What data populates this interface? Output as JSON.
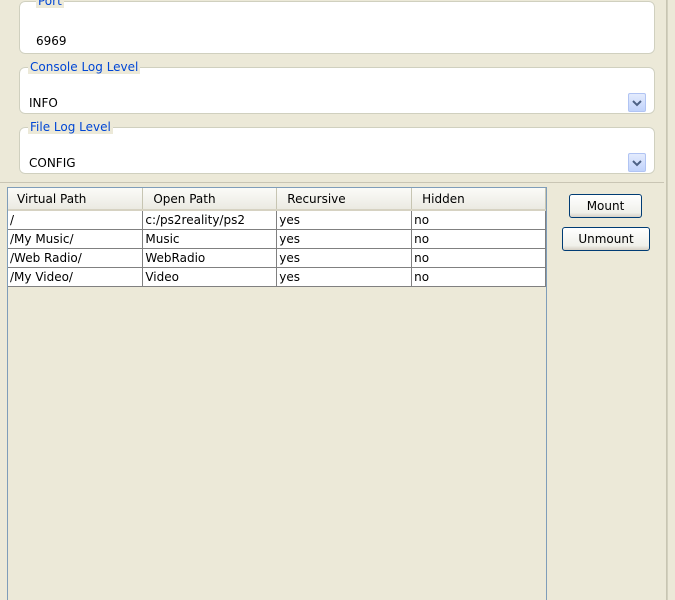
{
  "port": {
    "legend": "Port",
    "value": "6969"
  },
  "console_log_level": {
    "legend": "Console Log Level",
    "value": "INFO",
    "icon": "chevron-down-icon"
  },
  "file_log_level": {
    "legend": "File Log Level",
    "value": "CONFIG",
    "icon": "chevron-down-icon"
  },
  "table": {
    "columns": [
      "Virtual Path",
      "Open Path",
      "Recursive",
      "Hidden"
    ],
    "rows": [
      [
        "/",
        "c:/ps2reality/ps2",
        "yes",
        "no"
      ],
      [
        "/My Music/",
        "Music",
        "yes",
        "no"
      ],
      [
        "/Web Radio/",
        "WebRadio",
        "yes",
        "no"
      ],
      [
        "/My Video/",
        "Video",
        "yes",
        "no"
      ]
    ]
  },
  "buttons": {
    "mount": "Mount",
    "unmount": "Unmount"
  },
  "colors": {
    "legend_text": "#0046d5",
    "window_bg": "#ece9d8",
    "button_border": "#003c74"
  }
}
